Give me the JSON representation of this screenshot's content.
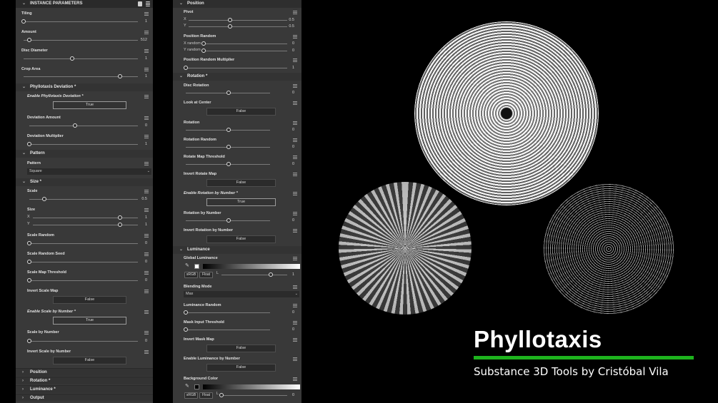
{
  "left": {
    "header": "INSTANCE PARAMETERS",
    "tiling": {
      "label": "Tiling",
      "value": "1"
    },
    "amount": {
      "label": "Amount",
      "value": "512"
    },
    "disc_diameter": {
      "label": "Disc Diameter",
      "value": "1"
    },
    "crop_area": {
      "label": "Crop Area",
      "value": "1"
    },
    "phyllotaxis_deviation": {
      "header": "Phyllotaxis Deviation *",
      "enable_label": "Enable Phyllotaxis Deviation *",
      "enable_value": "True",
      "amount_label": "Deviation Amount",
      "amount_value": "0",
      "multiplier_label": "Deviation Multiplier",
      "multiplier_value": "1"
    },
    "pattern": {
      "header": "Pattern",
      "label": "Pattern",
      "value": "Square"
    },
    "size": {
      "header": "Size *",
      "scale_label": "Scale",
      "scale_value": "0.5",
      "size_label": "Size",
      "x_label": "X",
      "x_value": "1",
      "y_label": "Y",
      "y_value": "1",
      "scale_random_label": "Scale Random",
      "scale_random_value": "0",
      "scale_random_seed_label": "Scale Random Seed",
      "scale_random_seed_value": "0",
      "scale_map_threshold_label": "Scale Map Threshold",
      "scale_map_threshold_value": "0",
      "invert_scale_map_label": "Invert Scale Map",
      "invert_scale_map_value": "False",
      "enable_scale_by_number_label": "Enable Scale by Number *",
      "enable_scale_by_number_value": "True",
      "scale_by_number_label": "Scale by Number",
      "scale_by_number_value": "0",
      "invert_scale_by_number_label": "Invert Scale by Number",
      "invert_scale_by_number_value": "False"
    },
    "collapsed": [
      "Position",
      "Rotation *",
      "Luminance *",
      "Output"
    ]
  },
  "right": {
    "position": {
      "header": "Position",
      "pivot_label": "Pivot",
      "x_label": "X",
      "x_value": "0.5",
      "y_label": "Y",
      "y_value": "0.5",
      "random_label": "Position Random",
      "x_random_label": "X random",
      "x_random_value": "0",
      "y_random_label": "Y random",
      "y_random_value": "0",
      "multiplier_label": "Position Random Multiplier",
      "multiplier_value": "1"
    },
    "rotation": {
      "header": "Rotation *",
      "disc_rotation_label": "Disc Rotation",
      "disc_rotation_value": "0",
      "look_at_center_label": "Look at Center",
      "look_at_center_value": "False",
      "rotation_label": "Rotation",
      "rotation_value": "0",
      "rotation_random_label": "Rotation Random",
      "rotation_random_value": "0",
      "rotate_map_threshold_label": "Rotate Map Threshold",
      "rotate_map_threshold_value": "0",
      "invert_rotate_map_label": "Invert Rotate Map",
      "invert_rotate_map_value": "False",
      "enable_rotation_by_number_label": "Enable Rotation by Number *",
      "enable_rotation_by_number_value": "True",
      "rotation_by_number_label": "Rotation by Number",
      "rotation_by_number_value": "0",
      "invert_rotation_by_number_label": "Invert Rotation by Number",
      "invert_rotation_by_number_value": "False"
    },
    "luminance": {
      "header": "Luminance",
      "global_label": "Global Luminance",
      "srgb": "sRGB",
      "float": "Float",
      "l_label": "L",
      "global_value": "1",
      "blending_label": "Blending Mode",
      "blending_value": "Max",
      "random_label": "Luminance Random",
      "random_value": "0",
      "mask_threshold_label": "Mask Input Threshold",
      "mask_threshold_value": "0",
      "invert_mask_label": "Invert Mask Map",
      "invert_mask_value": "False",
      "enable_by_number_label": "Enable Luminance by Number",
      "enable_by_number_value": "False",
      "bg_color_label": "Background Color",
      "bg_value": "0"
    }
  },
  "artwork": {
    "title": "Phyllotaxis",
    "subtitle": "Substance 3D Tools by Cristóbal Vila",
    "accent_color": "#1db31d"
  }
}
